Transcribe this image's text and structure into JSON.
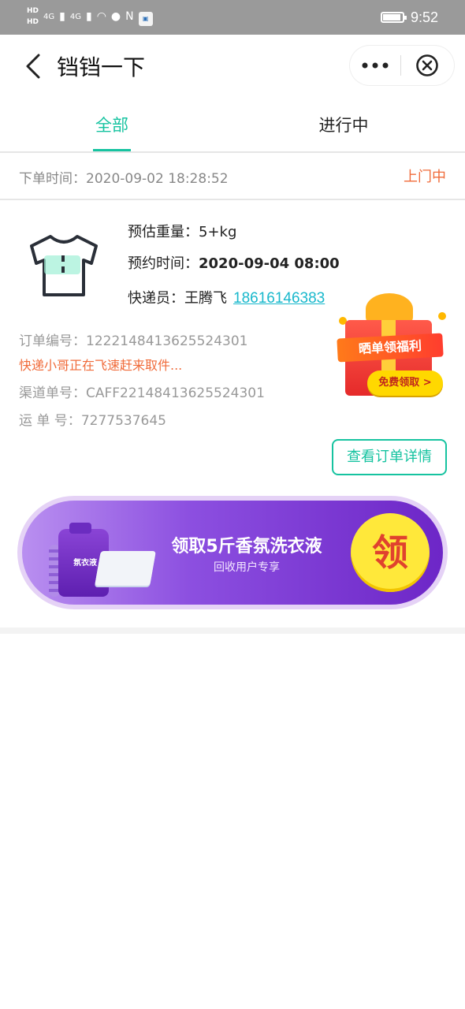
{
  "status_bar": {
    "network_labels": [
      "HD",
      "HD"
    ],
    "signal_labels": [
      "4G",
      "4G"
    ],
    "time": "9:52",
    "icons": [
      "signal-icon",
      "signal-icon",
      "wifi-icon",
      "wechat-icon",
      "nfc-icon",
      "app-icon",
      "battery-icon"
    ]
  },
  "header": {
    "title": "铛铛一下"
  },
  "tabs": [
    {
      "label": "全部",
      "active": true
    },
    {
      "label": "进行中",
      "active": false
    }
  ],
  "order": {
    "time_label": "下单时间：",
    "time_value": "2020-09-02 18:28:52",
    "status": "上门中",
    "weight_label": "预估重量：",
    "weight_value": "5+kg",
    "appointment_label": "预约时间：",
    "appointment_value": "2020-09-04 08:00",
    "courier_label": "快递员：",
    "courier_name": "王腾飞",
    "courier_phone": "18616146383",
    "order_no_label": "订单编号：",
    "order_no_value": "1222148413625524301",
    "hint": "快递小哥正在飞速赶来取件...",
    "channel_no_label": "渠道单号：",
    "channel_no_value": "CAFF22148413625524301",
    "waybill_label": "运 单 号：",
    "waybill_value": "7277537645",
    "detail_button": "查看订单详情"
  },
  "gift": {
    "banner_text": "晒单领福利",
    "button_text": "免费领取 >"
  },
  "promo": {
    "title": "领取5斤香氛洗衣液",
    "subtitle": "回收用户专享",
    "badge": "领",
    "product_label": "氛衣液"
  },
  "colors": {
    "accent": "#16c3a0",
    "status": "#f06b3a",
    "link": "#18b8cc",
    "promo_purple": "#8c4fe0"
  }
}
